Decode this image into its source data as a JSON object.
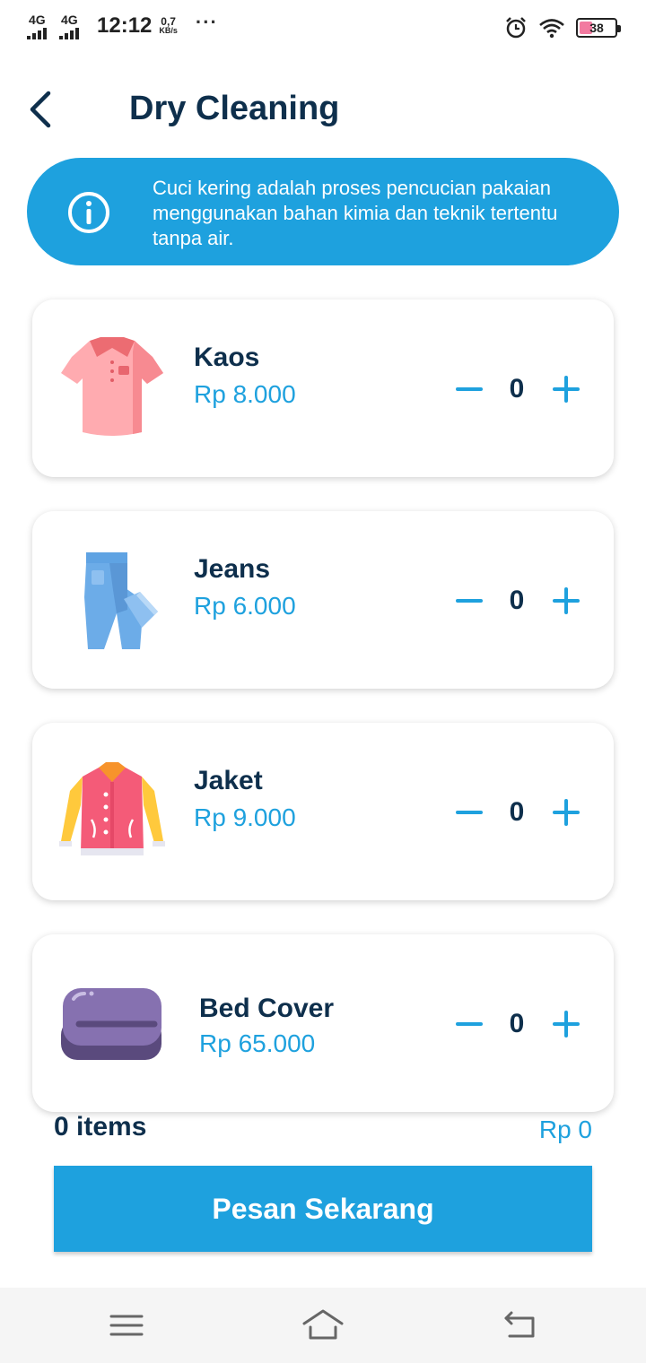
{
  "status_bar": {
    "network1": "4G",
    "network2": "4G",
    "time": "12:12",
    "speed_value": "0,7",
    "speed_unit": "KB/s",
    "more": "···",
    "battery_percent": "38",
    "battery_level": 0.38
  },
  "header": {
    "title": "Dry Cleaning",
    "back_icon": "chevron-left-icon"
  },
  "info_banner": {
    "icon": "info-icon",
    "text": "Cuci kering adalah proses pencucian pakaian menggunakan bahan kimia dan teknik tertentu tanpa air."
  },
  "items": [
    {
      "name": "Kaos",
      "price": "Rp 8.000",
      "qty": "0",
      "icon": "shirt-icon"
    },
    {
      "name": "Jeans",
      "price": "Rp 6.000",
      "qty": "0",
      "icon": "jeans-icon"
    },
    {
      "name": "Jaket",
      "price": "Rp 9.000",
      "qty": "0",
      "icon": "jacket-icon"
    },
    {
      "name": "Bed Cover",
      "price": "Rp 65.000",
      "qty": "0",
      "icon": "bed-cover-icon"
    }
  ],
  "summary": {
    "count": "0 items",
    "total": "Rp 0"
  },
  "order_button": "Pesan Sekarang",
  "colors": {
    "accent": "#1ea1de",
    "text_dark": "#0e2f4c"
  },
  "nav": {
    "menu_icon": "menu-icon",
    "home_icon": "home-icon",
    "back_icon": "back-icon"
  }
}
